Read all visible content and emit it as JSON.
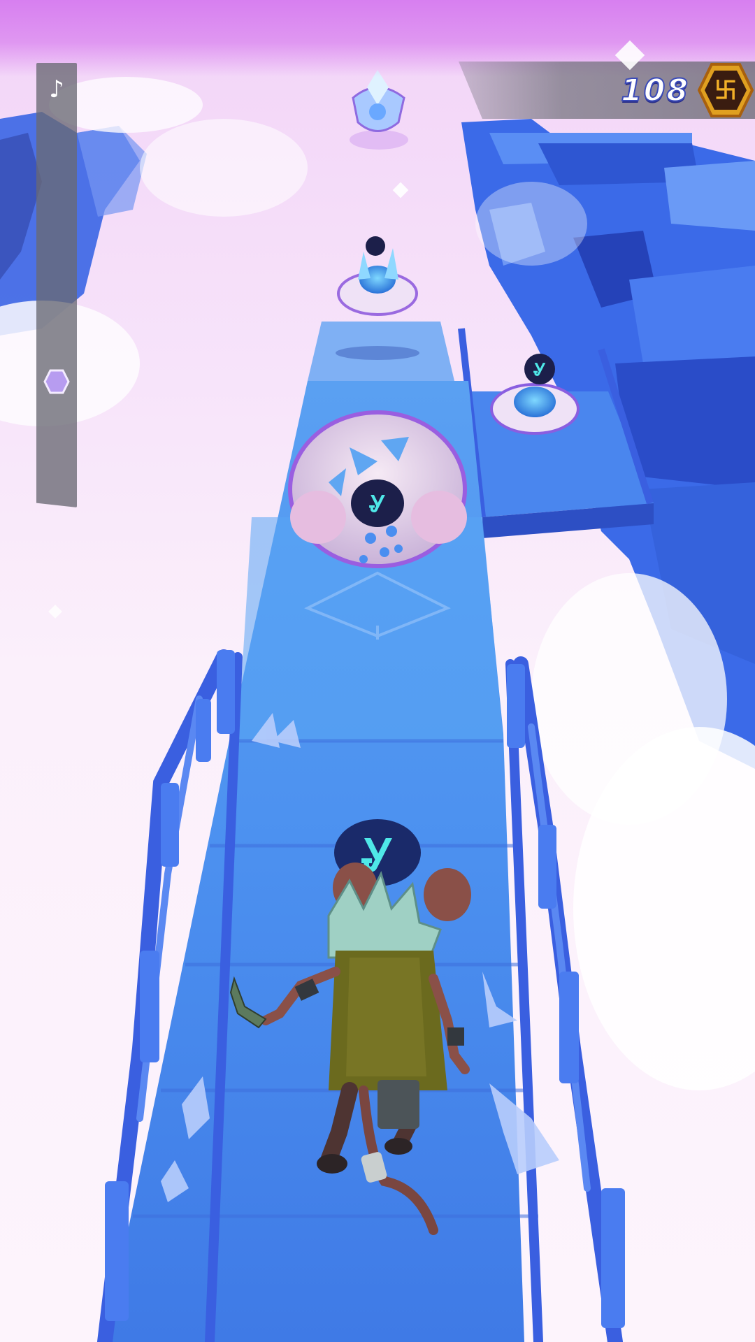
{
  "hud": {
    "score": "108",
    "music_icon": "music-note-icon",
    "coin_icon": "hexagon-rune-coin-icon",
    "progress_marker_icon": "hexagon-marker-icon",
    "run_progress": 0.72
  },
  "colors": {
    "sky_top": "#d77ff0",
    "path_blue": "#4a86ee",
    "rail_blue": "#3a5fe0",
    "coin_gold": "#e0a020",
    "rune_glow": "#4fe8e8"
  }
}
